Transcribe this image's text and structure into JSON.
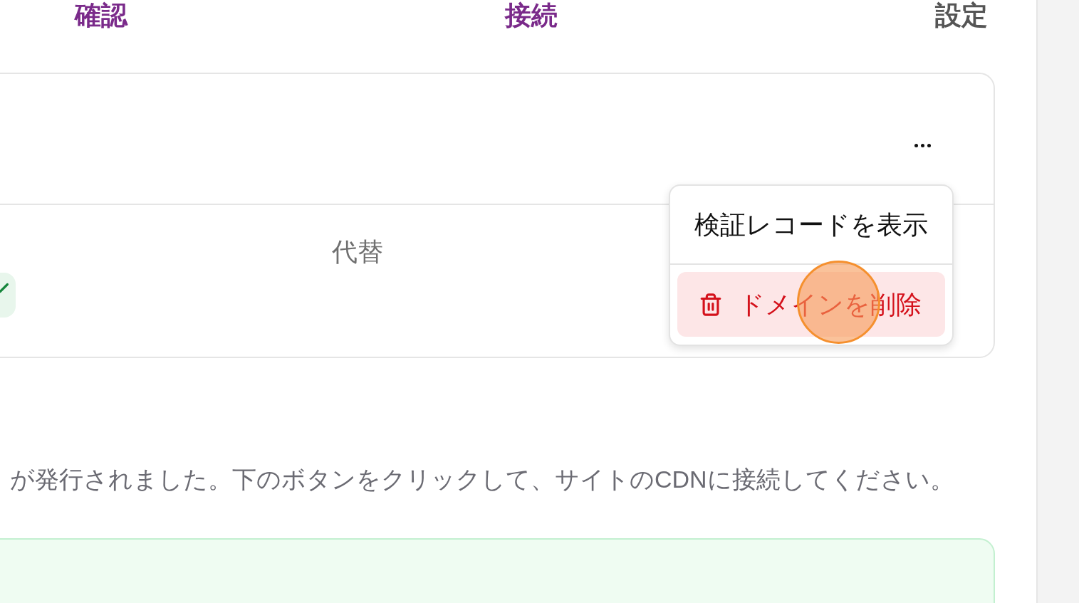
{
  "steps": [
    {
      "label": "確認",
      "done": true
    },
    {
      "label": "接続",
      "done": true
    },
    {
      "label": "設定",
      "done": false
    }
  ],
  "domain_card": {
    "column_header": "代替"
  },
  "menu": {
    "items": [
      {
        "label": "検証レコードを表示",
        "kind": "plain",
        "highlighted": false
      },
      {
        "label": "ドメインを削除",
        "kind": "danger",
        "highlighted": true
      }
    ]
  },
  "message": "が発行されました。下のボタンをクリックして、サイトのCDNに接続してください。"
}
